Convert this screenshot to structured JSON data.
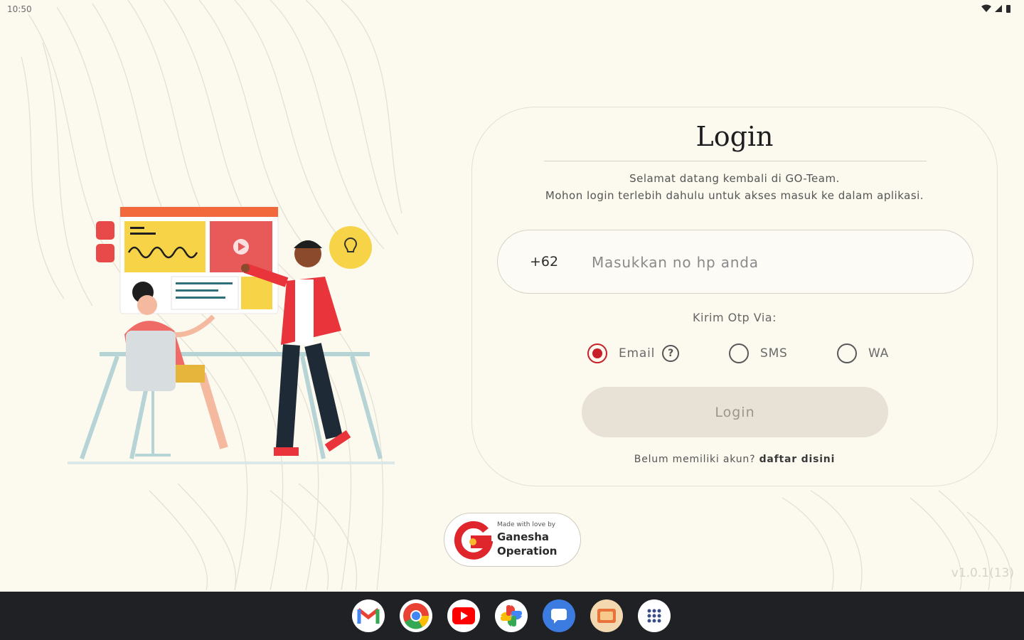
{
  "status_bar": {
    "time": "10:50"
  },
  "login": {
    "title": "Login",
    "welcome_line1": "Selamat datang kembali di GO-Team.",
    "welcome_line2": "Mohon login terlebih dahulu untuk akses masuk ke dalam aplikasi.",
    "phone_prefix": "+62",
    "phone_placeholder": "Masukkan no hp anda",
    "phone_value": "",
    "otp_label": "Kirim Otp Via:",
    "otp_options": [
      {
        "label": "Email",
        "selected": true
      },
      {
        "label": "SMS",
        "selected": false
      },
      {
        "label": "WA",
        "selected": false
      }
    ],
    "help_symbol": "?",
    "button_label": "Login",
    "register_prompt": "Belum memiliki akun?",
    "register_link": "daftar disini"
  },
  "badge": {
    "tagline": "Made with love by",
    "name_line1": "Ganesha",
    "name_line2": "Operation"
  },
  "version": "v1.0.1(13)",
  "taskbar": {
    "apps": [
      {
        "icon": "gmail-icon"
      },
      {
        "icon": "chrome-icon"
      },
      {
        "icon": "youtube-icon"
      },
      {
        "icon": "photos-icon"
      },
      {
        "icon": "messages-icon"
      },
      {
        "icon": "app-icon"
      },
      {
        "icon": "app-launcher-icon"
      }
    ]
  },
  "colors": {
    "background": "#fcf9ef",
    "accent_red": "#c8202a",
    "button_bg": "#e7e1d6",
    "taskbar": "#1f2125"
  }
}
